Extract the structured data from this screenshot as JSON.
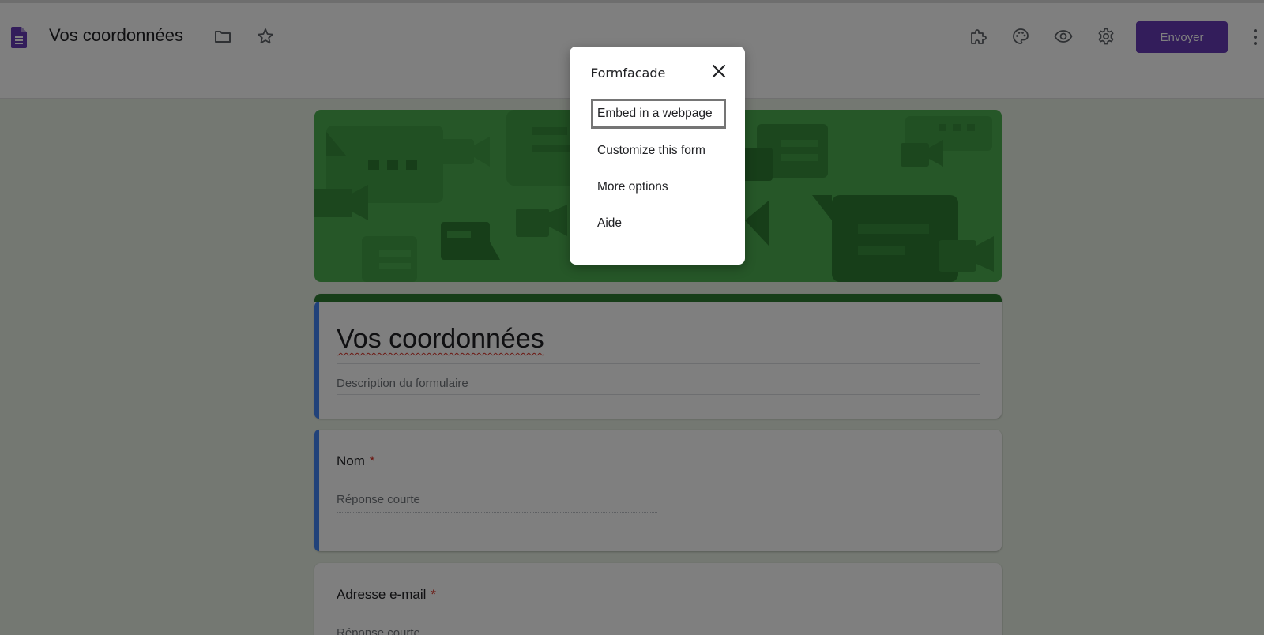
{
  "header": {
    "doc_title": "Vos coordonnées",
    "doc_icon": "forms-doc-icon",
    "icons": [
      "folder-icon",
      "star-icon",
      "puzzle-addon-icon",
      "palette-icon",
      "eye-preview-icon",
      "gear-icon",
      "more-vert-icon"
    ],
    "send_label": "Envoyer",
    "accent_color": "#673ab7"
  },
  "form": {
    "title": "Vos coordonnées",
    "description_placeholder": "Description du formulaire",
    "theme_color": "#4caf50",
    "questions": [
      {
        "label": "Nom",
        "required_mark": "*",
        "answer_placeholder": "Réponse courte"
      },
      {
        "label": "Adresse e-mail",
        "required_mark": "*",
        "answer_placeholder": "Réponse courte"
      }
    ]
  },
  "dialog": {
    "title": "Formfacade",
    "close_icon": "close-icon",
    "items": [
      {
        "label": "Embed in a webpage",
        "selected": true
      },
      {
        "label": "Customize this form",
        "selected": false
      },
      {
        "label": "More options",
        "selected": false
      },
      {
        "label": "Aide",
        "selected": false
      }
    ]
  }
}
